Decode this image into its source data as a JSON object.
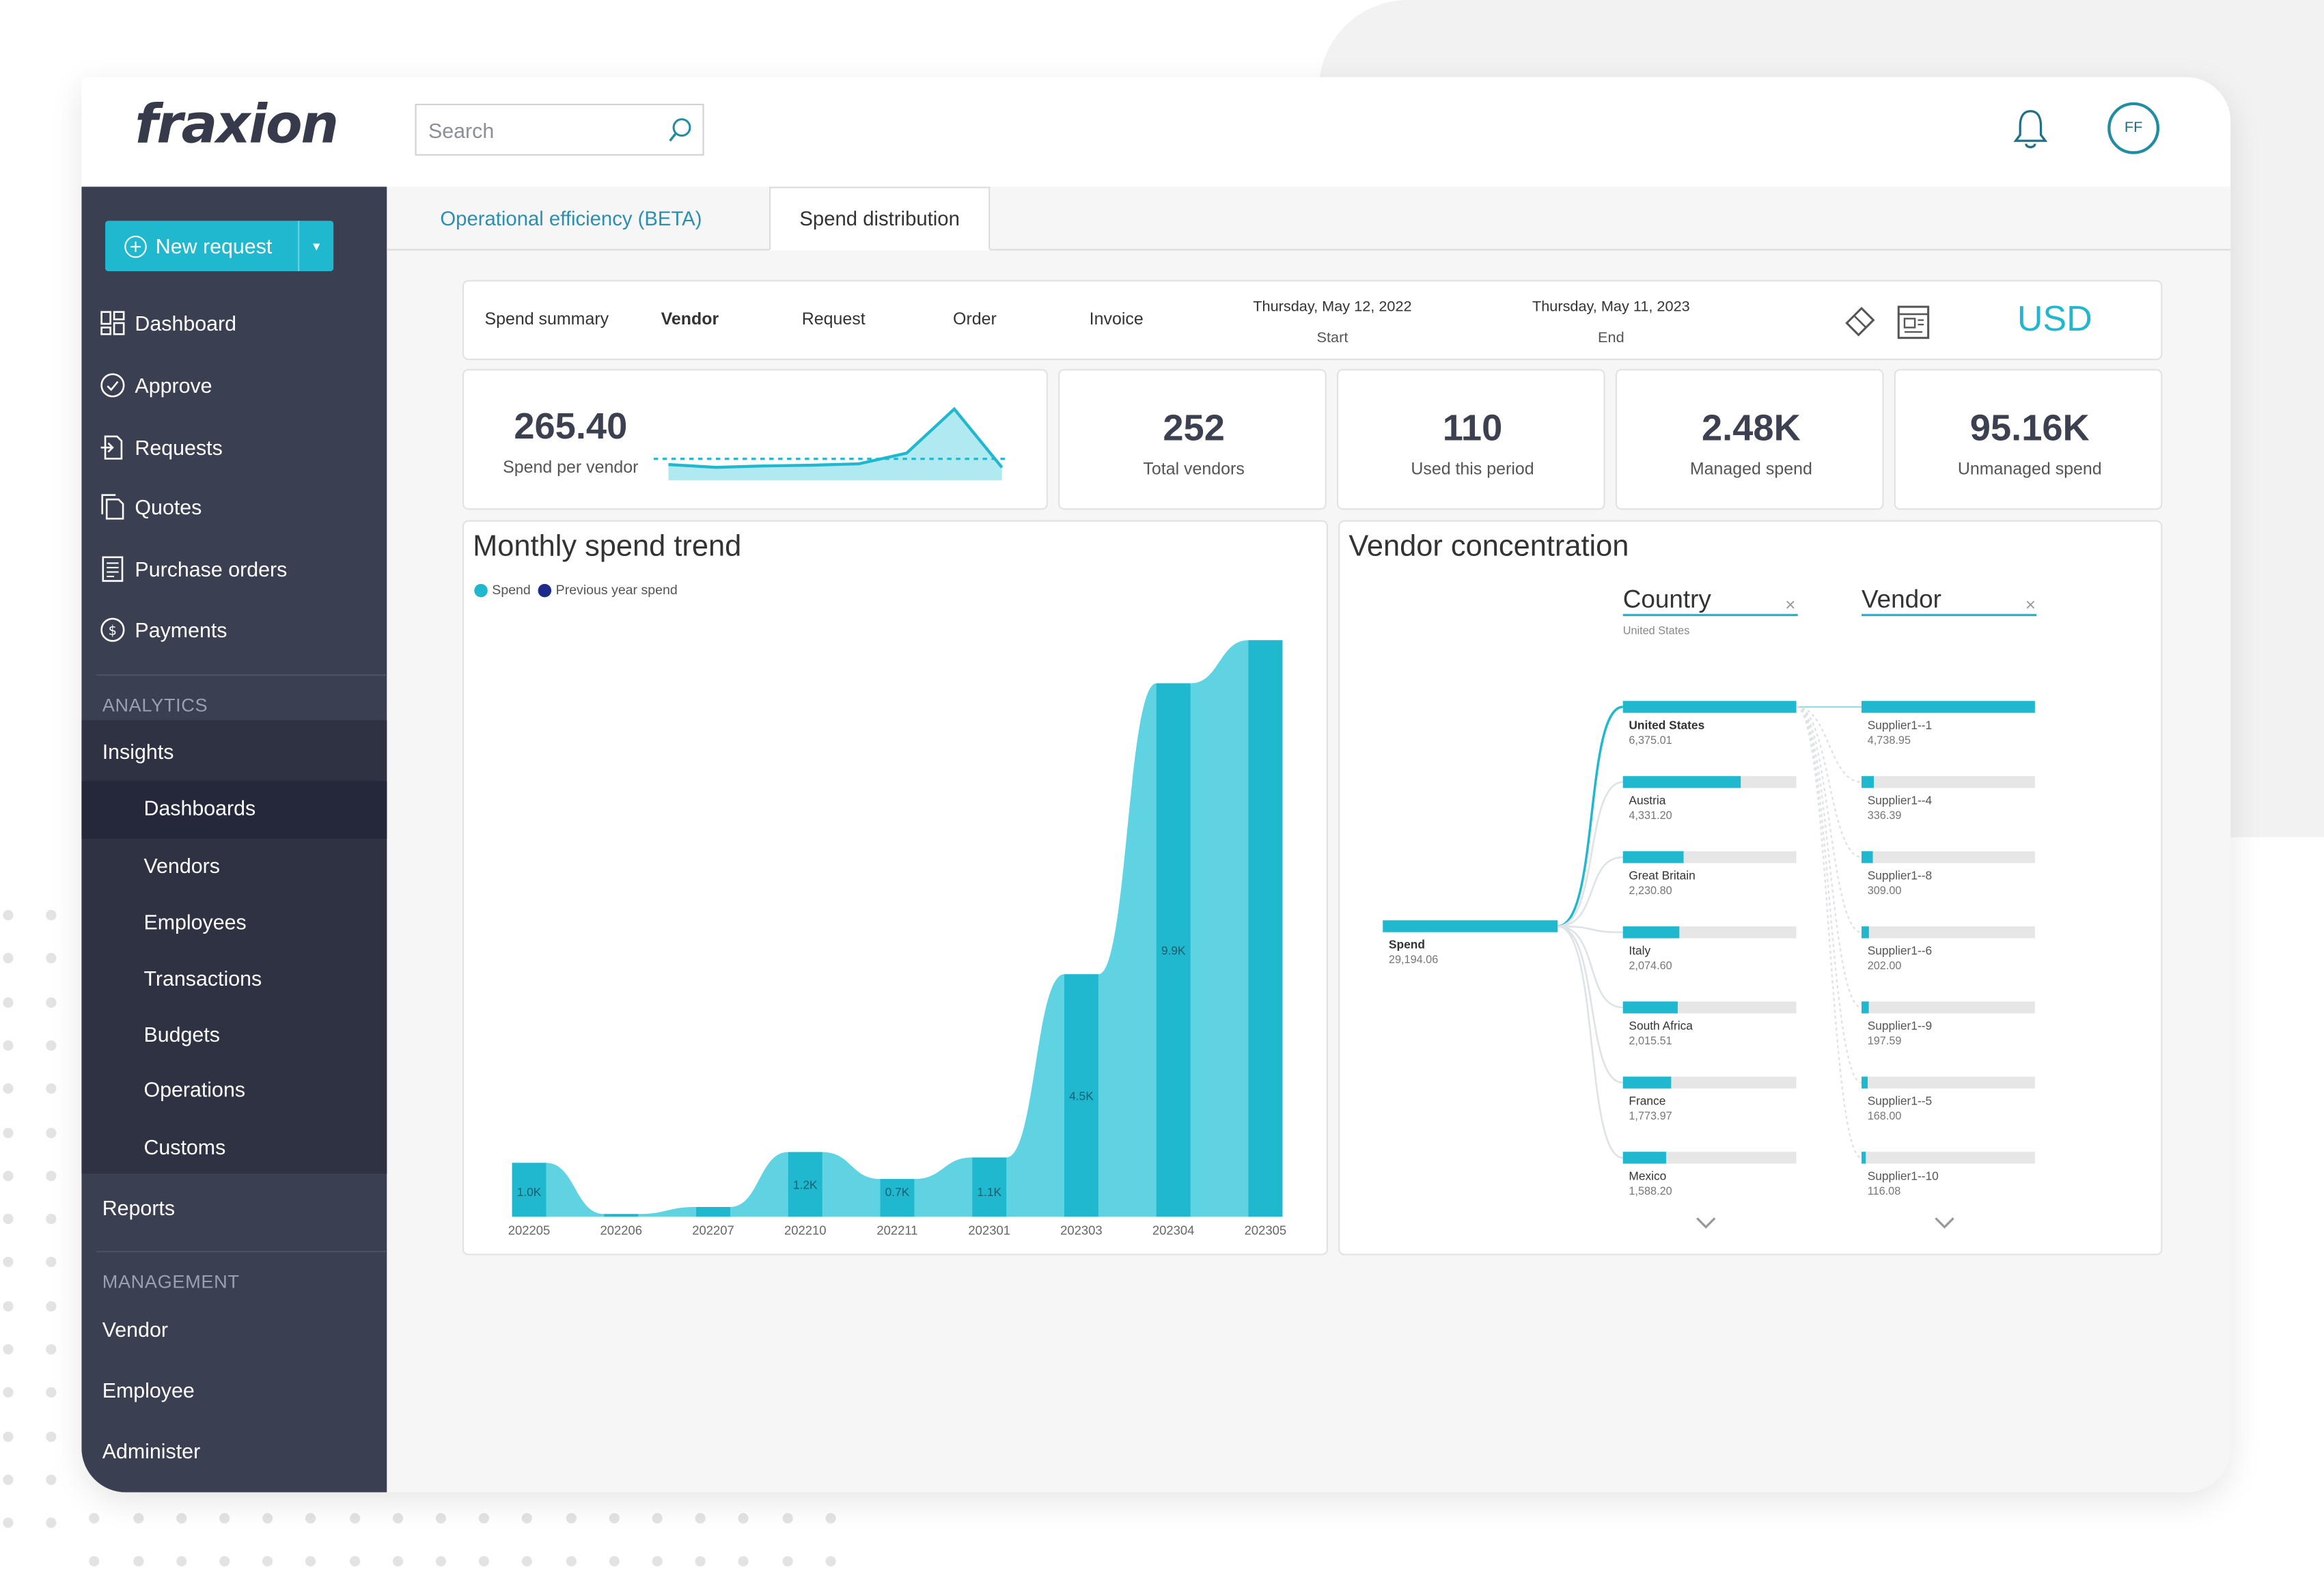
{
  "app": {
    "logo": "fraxion",
    "search_placeholder": "Search",
    "avatar_initials": "FF"
  },
  "sidebar": {
    "new_request": "New request",
    "main_items": [
      "Dashboard",
      "Approve",
      "Requests",
      "Quotes",
      "Purchase orders",
      "Payments"
    ],
    "analytics_title": "ANALYTICS",
    "insights": "Insights",
    "insights_sub": [
      "Dashboards",
      "Vendors",
      "Employees",
      "Transactions",
      "Budgets",
      "Operations",
      "Customs"
    ],
    "reports": "Reports",
    "management_title": "MANAGEMENT",
    "management_items": [
      "Vendor",
      "Employee",
      "Administer"
    ]
  },
  "tabs": [
    "Operational efficiency (BETA)",
    "Spend distribution"
  ],
  "filters": {
    "items": [
      "Spend summary",
      "Vendor",
      "Request",
      "Order",
      "Invoice"
    ],
    "start_date": "Thursday, May 12, 2022",
    "start_label": "Start",
    "end_date": "Thursday, May 11, 2023",
    "end_label": "End",
    "currency": "USD"
  },
  "kpis": [
    {
      "value": "265.40",
      "label": "Spend per vendor"
    },
    {
      "value": "252",
      "label": "Total vendors"
    },
    {
      "value": "110",
      "label": "Used this period"
    },
    {
      "value": "2.48K",
      "label": "Managed spend"
    },
    {
      "value": "95.16K",
      "label": "Unmanaged spend"
    }
  ],
  "trend_panel": {
    "title": "Monthly spend trend",
    "legend": [
      "Spend",
      "Previous year spend"
    ]
  },
  "concentration": {
    "title": "Vendor concentration",
    "country_header": "Country",
    "country_filter": "United States",
    "vendor_header": "Vendor",
    "root": {
      "label": "Spend",
      "value": "29,194.06"
    },
    "countries": [
      {
        "name": "United States",
        "value": "6,375.01"
      },
      {
        "name": "Austria",
        "value": "4,331.20"
      },
      {
        "name": "Great Britain",
        "value": "2,230.80"
      },
      {
        "name": "Italy",
        "value": "2,074.60"
      },
      {
        "name": "South Africa",
        "value": "2,015.51"
      },
      {
        "name": "France",
        "value": "1,773.97"
      },
      {
        "name": "Mexico",
        "value": "1,588.20"
      }
    ],
    "vendors": [
      {
        "name": "Supplier1--1",
        "value": "4,738.95"
      },
      {
        "name": "Supplier1--4",
        "value": "336.39"
      },
      {
        "name": "Supplier1--8",
        "value": "309.00"
      },
      {
        "name": "Supplier1--6",
        "value": "202.00"
      },
      {
        "name": "Supplier1--9",
        "value": "197.59"
      },
      {
        "name": "Supplier1--5",
        "value": "168.00"
      },
      {
        "name": "Supplier1--10",
        "value": "116.08"
      }
    ]
  },
  "colors": {
    "accent": "#1fb8cf",
    "sidebar": "#3b3f52",
    "area": "#5fd3e2",
    "bar": "#1fb8cf",
    "prev_year": "#1c2a8c"
  },
  "chart_data": [
    {
      "type": "bar",
      "name": "monthly-spend",
      "categories": [
        "202205",
        "202206",
        "202207",
        "202210",
        "202211",
        "202301",
        "202303",
        "202304",
        "202305"
      ],
      "series": [
        {
          "name": "Spend",
          "values": [
            1000,
            50,
            180,
            1200,
            700,
            1100,
            4500,
            9900,
            10700
          ]
        }
      ],
      "data_labels": [
        "1.0K",
        "",
        "",
        "1.2K",
        "0.7K",
        "1.1K",
        "4.5K",
        "9.9K",
        ""
      ],
      "legend": "top-left"
    },
    {
      "type": "line",
      "name": "spend-per-vendor-sparkline",
      "values": [
        0.22,
        0.18,
        0.2,
        0.21,
        0.23,
        0.38,
        1.0,
        0.18
      ],
      "reference": 0.3
    },
    {
      "type": "bar",
      "name": "vendor-concentration-countries",
      "categories": [
        "United States",
        "Austria",
        "Great Britain",
        "Italy",
        "South Africa",
        "France",
        "Mexico"
      ],
      "values": [
        6375.01,
        4331.2,
        2230.8,
        2074.6,
        2015.51,
        1773.97,
        1588.2
      ],
      "xlim": [
        0,
        6375.01
      ]
    },
    {
      "type": "bar",
      "name": "vendor-concentration-vendors",
      "categories": [
        "Supplier1--1",
        "Supplier1--4",
        "Supplier1--8",
        "Supplier1--6",
        "Supplier1--9",
        "Supplier1--5",
        "Supplier1--10"
      ],
      "values": [
        4738.95,
        336.39,
        309.0,
        202.0,
        197.59,
        168.0,
        116.08
      ],
      "xlim": [
        0,
        4738.95
      ]
    }
  ]
}
